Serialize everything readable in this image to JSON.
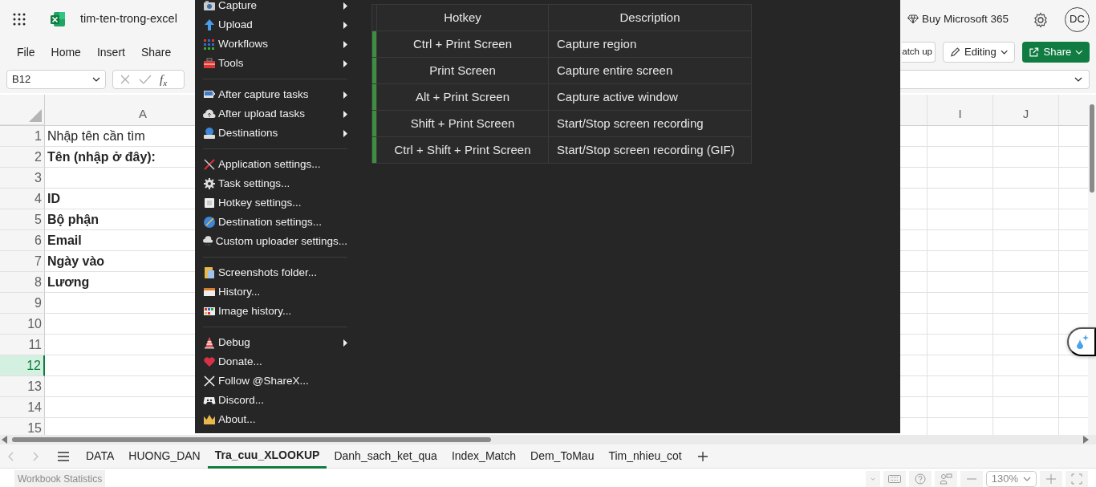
{
  "app": {
    "title": "tim-ten-trong-excel",
    "buy_label": "Buy Microsoft 365",
    "avatar": "DC"
  },
  "ribbon_tabs": [
    {
      "label": "File"
    },
    {
      "label": "Home"
    },
    {
      "label": "Insert"
    },
    {
      "label": "Share"
    }
  ],
  "ribbon_buttons": {
    "catch_up": "atch up",
    "editing": "Editing",
    "share": "Share"
  },
  "formula_bar": {
    "name_box": "B12",
    "fx": "f$_{x}$"
  },
  "grid": {
    "columns": [
      {
        "label": "A"
      },
      {
        "label": "I"
      },
      {
        "label": "J"
      }
    ],
    "rows": [
      {
        "number": "1",
        "cell_a": "Nhập tên cần tìm",
        "bold": false,
        "selected": false
      },
      {
        "number": "2",
        "cell_a": "Tên (nhập ở đây):",
        "bold": true,
        "selected": false
      },
      {
        "number": "3",
        "selected": false
      },
      {
        "number": "4",
        "cell_a": "ID",
        "bold": true,
        "selected": false
      },
      {
        "number": "5",
        "cell_a": "Bộ phận",
        "bold": true,
        "selected": false
      },
      {
        "number": "6",
        "cell_a": "Email",
        "bold": true,
        "selected": false
      },
      {
        "number": "7",
        "cell_a": "Ngày vào",
        "bold": true,
        "selected": false
      },
      {
        "number": "8",
        "cell_a": "Lương",
        "bold": true,
        "selected": false
      },
      {
        "number": "9",
        "selected": false
      },
      {
        "number": "10",
        "selected": false
      },
      {
        "number": "11",
        "selected": false
      },
      {
        "number": "12",
        "selected": true
      },
      {
        "number": "13",
        "selected": false
      },
      {
        "number": "14",
        "selected": false
      },
      {
        "number": "15",
        "selected": false
      }
    ]
  },
  "sharex_menu": {
    "items": [
      {
        "kind": "item",
        "label": "Capture",
        "submenu": true
      },
      {
        "kind": "item",
        "label": "Upload",
        "submenu": true
      },
      {
        "kind": "item",
        "label": "Workflows",
        "submenu": true
      },
      {
        "kind": "item",
        "label": "Tools",
        "submenu": true
      },
      {
        "kind": "separator"
      },
      {
        "kind": "item",
        "label": "After capture tasks",
        "submenu": true
      },
      {
        "kind": "item",
        "label": "After upload tasks",
        "submenu": true
      },
      {
        "kind": "item",
        "label": "Destinations",
        "submenu": true
      },
      {
        "kind": "separator"
      },
      {
        "kind": "item",
        "label": "Application settings...",
        "submenu": false
      },
      {
        "kind": "item",
        "label": "Task settings...",
        "submenu": false
      },
      {
        "kind": "item",
        "label": "Hotkey settings...",
        "submenu": false
      },
      {
        "kind": "item",
        "label": "Destination settings...",
        "submenu": false
      },
      {
        "kind": "item",
        "label": "Custom uploader settings...",
        "submenu": false
      },
      {
        "kind": "separator"
      },
      {
        "kind": "item",
        "label": "Screenshots folder...",
        "submenu": false
      },
      {
        "kind": "item",
        "label": "History...",
        "submenu": false
      },
      {
        "kind": "item",
        "label": "Image history...",
        "submenu": false
      },
      {
        "kind": "separator"
      },
      {
        "kind": "item",
        "label": "Debug",
        "submenu": true
      },
      {
        "kind": "item",
        "label": "Donate...",
        "submenu": false
      },
      {
        "kind": "item",
        "label": "Follow @ShareX...",
        "submenu": false
      },
      {
        "kind": "item",
        "label": "Discord...",
        "submenu": false
      },
      {
        "kind": "item",
        "label": "About...",
        "submenu": false
      }
    ]
  },
  "hotkeys": {
    "columns": [
      "Hotkey",
      "Description"
    ],
    "rows": [
      {
        "hotkey": "Ctrl + Print Screen",
        "description": "Capture region",
        "enabled": true
      },
      {
        "hotkey": "Print Screen",
        "description": "Capture entire screen",
        "enabled": true
      },
      {
        "hotkey": "Alt + Print Screen",
        "description": "Capture active window",
        "enabled": true
      },
      {
        "hotkey": "Shift + Print Screen",
        "description": "Start/Stop screen recording",
        "enabled": true
      },
      {
        "hotkey": "Ctrl + Shift + Print Screen",
        "description": "Start/Stop screen recording (GIF)",
        "enabled": true
      }
    ]
  },
  "sheet_tabs": [
    {
      "label": "DATA",
      "selected": false
    },
    {
      "label": "HUONG_DAN",
      "selected": false
    },
    {
      "label": "Tra_cuu_XLOOKUP",
      "selected": true
    },
    {
      "label": "Danh_sach_ket_qua",
      "selected": false
    },
    {
      "label": "Index_Match",
      "selected": false
    },
    {
      "label": "Dem_ToMau",
      "selected": false
    },
    {
      "label": "Tim_nhieu_cot",
      "selected": false
    }
  ],
  "status_bar": {
    "label": "Workbook Statistics",
    "zoom": "130%"
  }
}
